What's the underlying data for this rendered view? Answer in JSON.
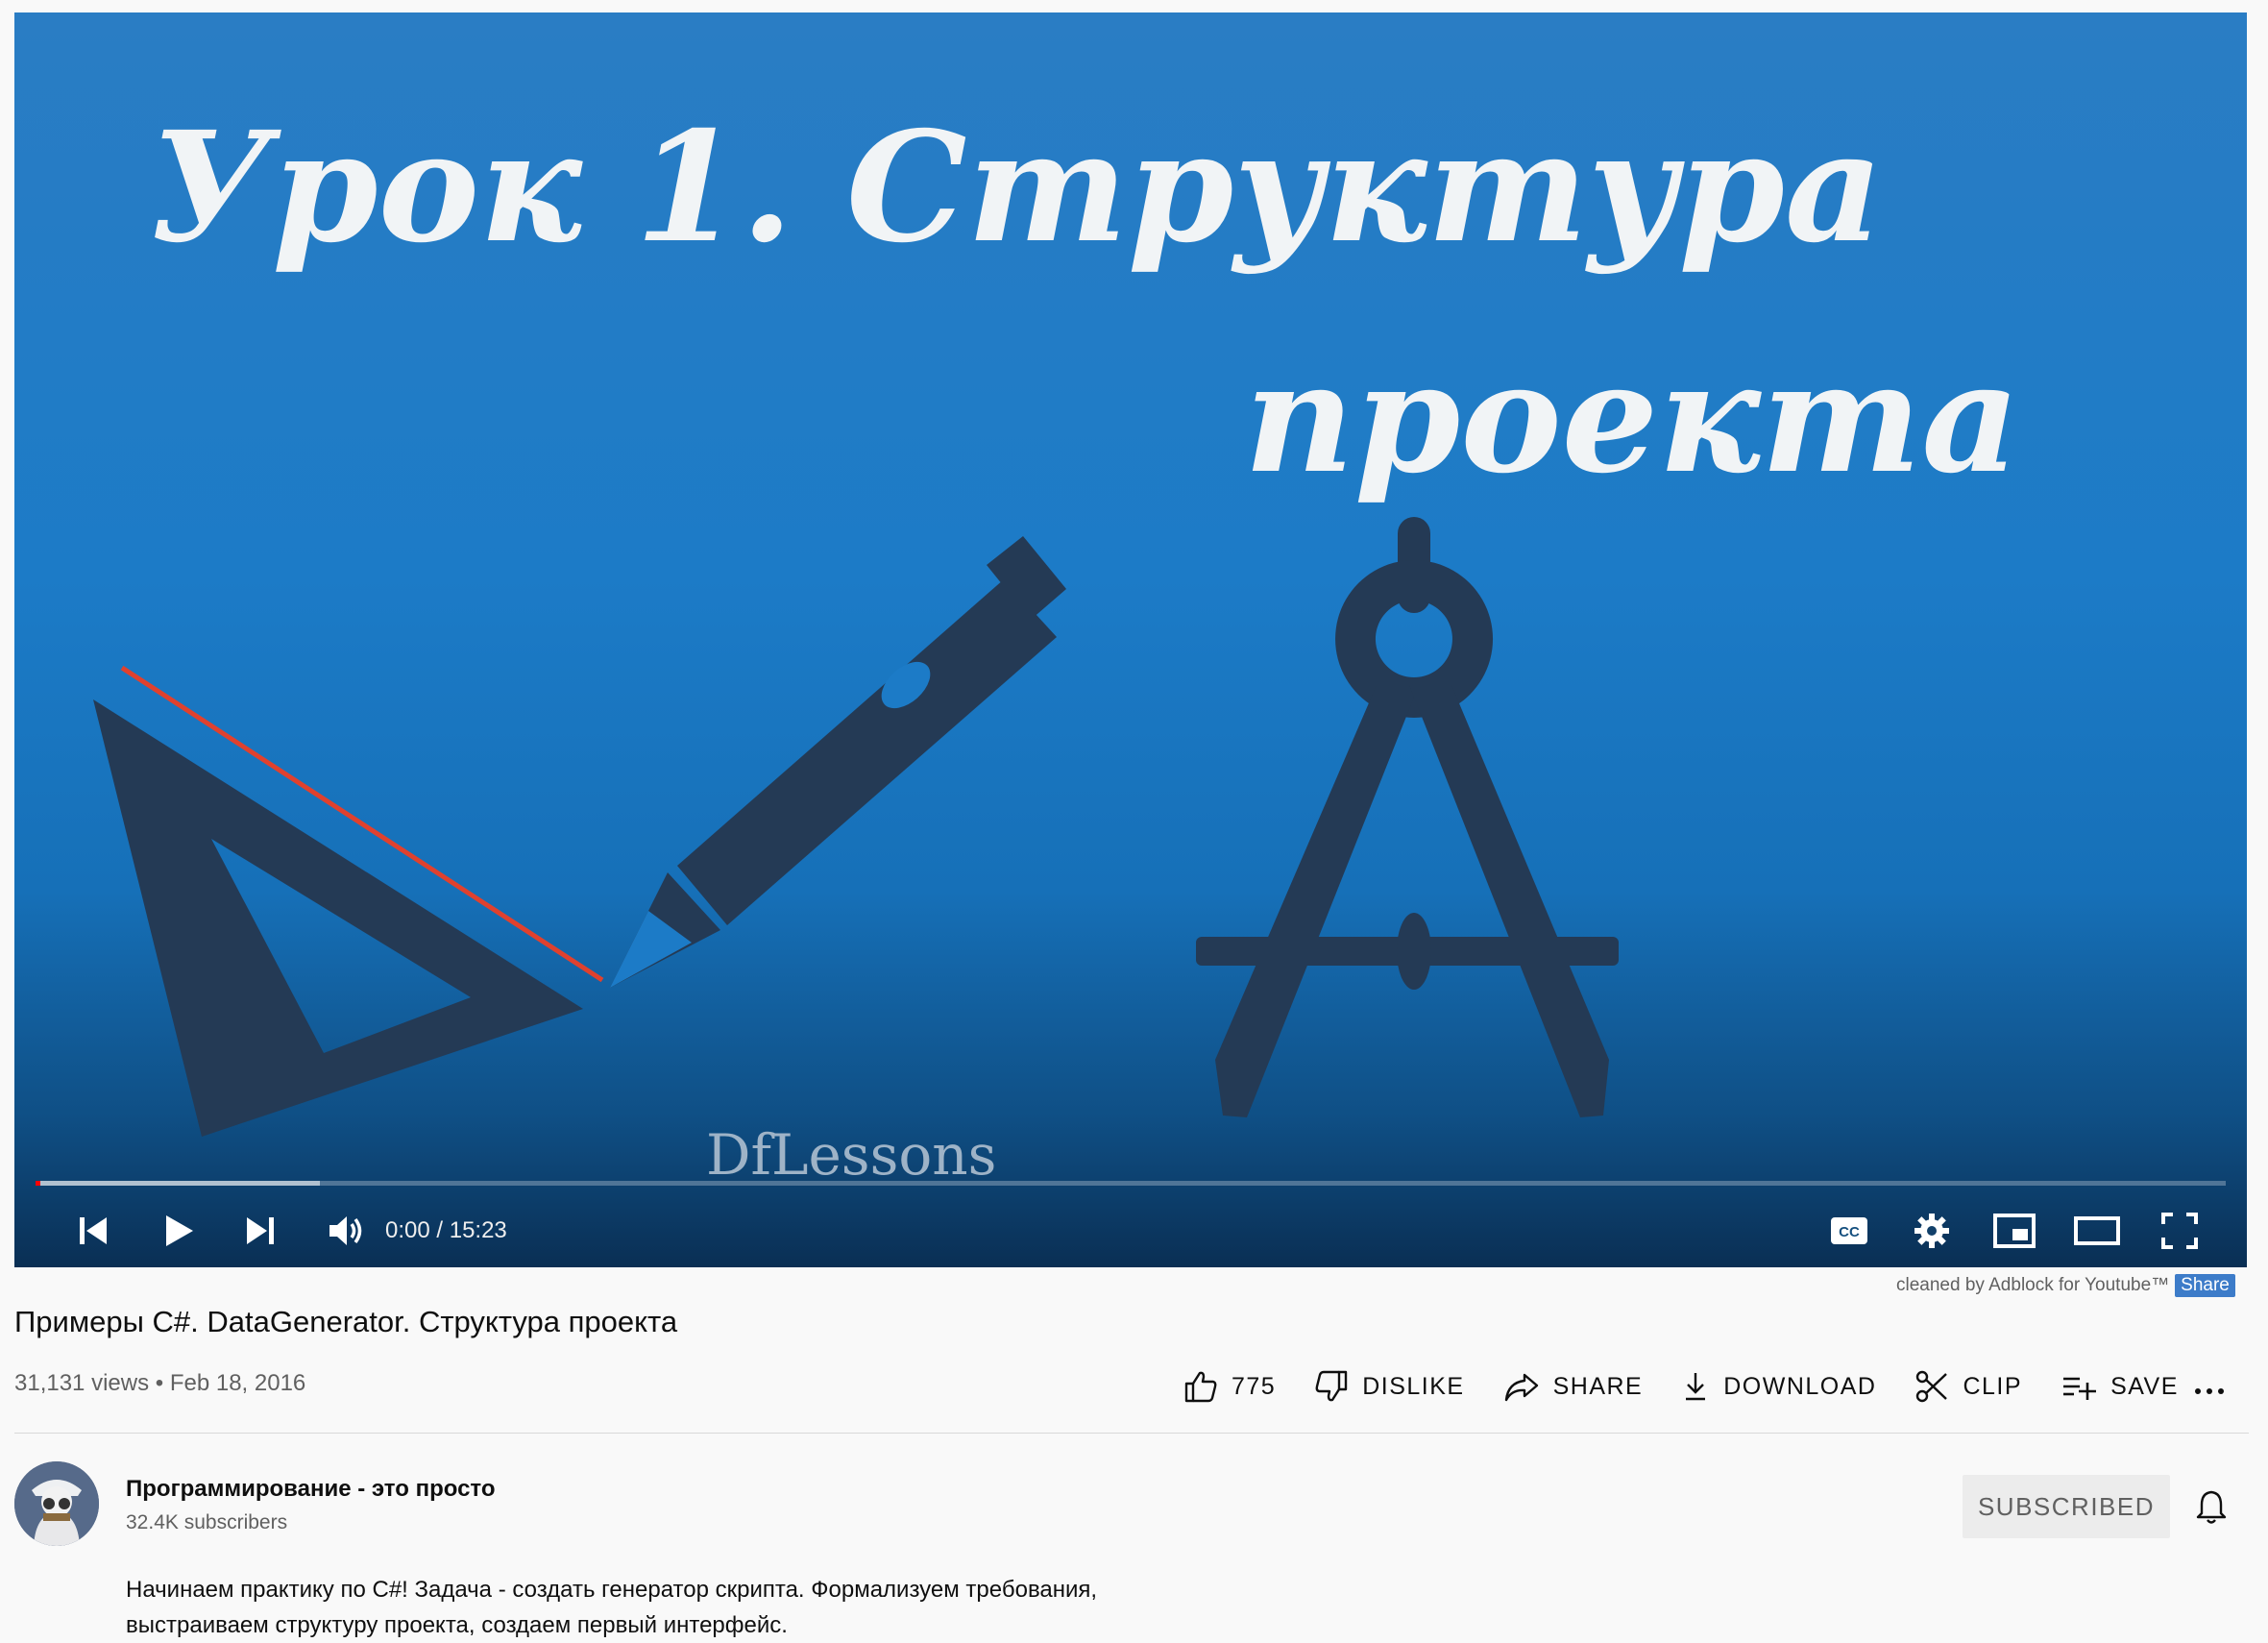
{
  "player": {
    "frame": {
      "title_line1": "Урок 1. Структура",
      "title_line2": "проекта",
      "watermark": "DfLessons"
    },
    "progress": {
      "played_fraction": 0.0,
      "buffered_fraction": 0.13
    },
    "time": "0:00 / 15:23",
    "controls": {
      "left": [
        "previous-icon",
        "play-icon",
        "next-icon",
        "volume-icon"
      ],
      "right": [
        "subtitles-cc-icon",
        "settings-gear-icon",
        "miniplayer-icon",
        "theater-mode-icon",
        "fullscreen-icon"
      ]
    }
  },
  "adblock": {
    "text": "cleaned by Adblock for Youtube™",
    "share": "Share"
  },
  "video": {
    "title": "Примеры C#. DataGenerator. Структура проекта",
    "meta": "31,131 views • Feb 18, 2016"
  },
  "actions": {
    "like_count": "775",
    "dislike": "DISLIKE",
    "share": "SHARE",
    "download": "DOWNLOAD",
    "clip": "CLIP",
    "save": "SAVE",
    "more": "more-horizontal-icon"
  },
  "channel": {
    "name": "Программирование - это просто",
    "subscribers": "32.4K subscribers",
    "subscribe_label": "SUBSCRIBED",
    "bell": "bell-icon"
  },
  "description": {
    "line1": "Начинаем практику по C#! Задача - создать генератор скрипта. Формализуем требования,",
    "line2": "выстраиваем структуру проекта, создаем первый интерфейс."
  },
  "colors": {
    "video_bg": "#1c7bc7",
    "tools": "#243a55",
    "red_line": "#e0412e",
    "progress": "#ff0000",
    "page_bg": "#f9f9f9"
  }
}
